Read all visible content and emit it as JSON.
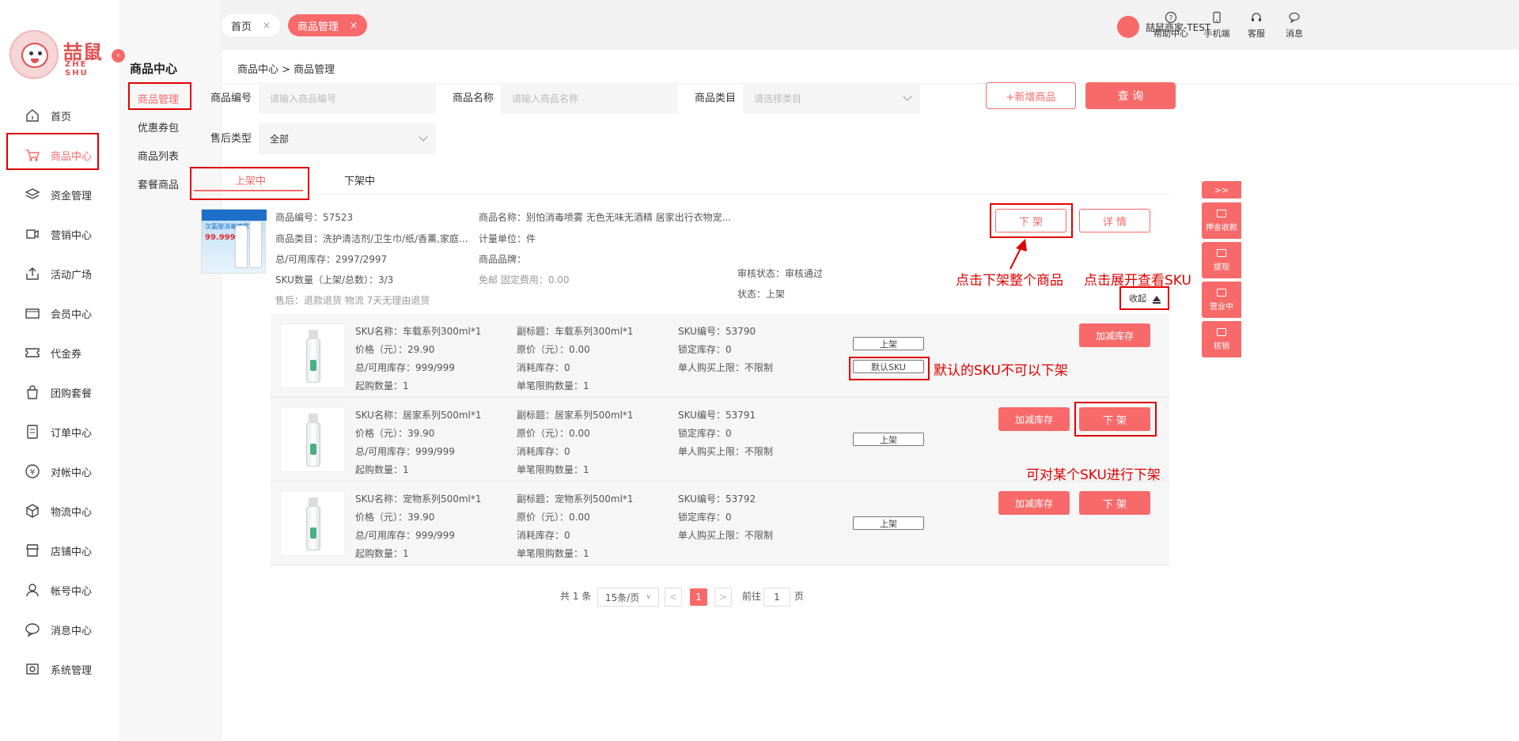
{
  "brand": {
    "name": "喆鼠",
    "sub": "ZHE SHU"
  },
  "nav": [
    {
      "label": "首页",
      "icon": "home-icon"
    },
    {
      "label": "商品中心",
      "icon": "cart-icon"
    },
    {
      "label": "资金管理",
      "icon": "layers-icon"
    },
    {
      "label": "营销中心",
      "icon": "marketing-icon"
    },
    {
      "label": "活动广场",
      "icon": "upload-box-icon"
    },
    {
      "label": "会员中心",
      "icon": "vip-card-icon"
    },
    {
      "label": "代金券",
      "icon": "coupon-icon"
    },
    {
      "label": "团购套餐",
      "icon": "bag-icon"
    },
    {
      "label": "订单中心",
      "icon": "order-icon"
    },
    {
      "label": "对帐中心",
      "icon": "yen-icon"
    },
    {
      "label": "物流中心",
      "icon": "box-icon"
    },
    {
      "label": "店铺中心",
      "icon": "store-icon"
    },
    {
      "label": "帐号中心",
      "icon": "user-icon"
    },
    {
      "label": "消息中心",
      "icon": "chat-icon"
    },
    {
      "label": "系统管理",
      "icon": "settings-icon"
    }
  ],
  "subnav": {
    "title": "商品中心",
    "items": [
      "商品管理",
      "优惠券包",
      "商品列表",
      "套餐商品"
    ]
  },
  "tabs": {
    "home": "首页",
    "current": "商品管理",
    "close": "×"
  },
  "toolbar": {
    "help": "帮助中心",
    "mobile": "手机端",
    "service": "客服",
    "message": "消息",
    "user": "喆鼠商家-TEST"
  },
  "breadcrumb": "商品中心  > 商品管理",
  "filters": {
    "code_label": "商品编号",
    "code_placeholder": "请输入商品编号",
    "name_label": "商品名称",
    "name_placeholder": "请输入商品名称",
    "category_label": "商品类目",
    "category_placeholder": "请选择类目",
    "aftersale_label": "售后类型",
    "aftersale_value": "全部",
    "add_button": "+新增商品",
    "query_button": "查 询"
  },
  "status_tabs": {
    "on": "上架中",
    "off": "下架中"
  },
  "product": {
    "code": "商品编号：57523",
    "name": "商品名称：别怕消毒喷雾 无色无味无酒精 居家出行衣物宠...",
    "category": "商品类目：洗护清洁剂/卫生巾/纸/香薰,家庭...",
    "unit": "计量单位：件",
    "stock": "总/可用库存：2997/2997",
    "brand": "商品品牌：",
    "sku_count": "SKU数量（上架/总数）：3/3",
    "shipping": "免邮   固定费用：0.00",
    "audit": "审核状态：审核通过",
    "aftersale": "售后：退款退货   物流   7天无理由退货",
    "status": "状态：上架",
    "img_title": "次氯酸消毒喷雾",
    "img_pct": "99.999%",
    "btn_off": "下 架",
    "btn_detail": "详 情",
    "collapse": "收起"
  },
  "skus": [
    {
      "name": "SKU名称：车载系列300ml*1",
      "subtitle": "副标题：车载系列300ml*1",
      "code": "SKU编号：53790",
      "price": "价格（元）：29.90",
      "orig": "原价（元）：0.00",
      "locked": "锁定库存：0",
      "stock": "总/可用库存：999/999",
      "consumed": "消耗库存：0",
      "limit": "单人购买上限：不限制",
      "min": "起购数量：1",
      "single": "单笔限购数量：1",
      "chip1": "上架",
      "chip2": "默认SKU",
      "btn_stock": "加减库存",
      "btn_off": ""
    },
    {
      "name": "SKU名称：居家系列500ml*1",
      "subtitle": "副标题：居家系列500ml*1",
      "code": "SKU编号：53791",
      "price": "价格（元）：39.90",
      "orig": "原价（元）：0.00",
      "locked": "锁定库存：0",
      "stock": "总/可用库存：999/999",
      "consumed": "消耗库存：0",
      "limit": "单人购买上限：不限制",
      "min": "起购数量：1",
      "single": "单笔限购数量：1",
      "chip1": "上架",
      "chip2": "",
      "btn_stock": "加减库存",
      "btn_off": "下 架"
    },
    {
      "name": "SKU名称：宠物系列500ml*1",
      "subtitle": "副标题：宠物系列500ml*1",
      "code": "SKU编号：53792",
      "price": "价格（元）：39.90",
      "orig": "原价（元）：0.00",
      "locked": "锁定库存：0",
      "stock": "总/可用库存：999/999",
      "consumed": "消耗库存：0",
      "limit": "单人购买上限：不限制",
      "min": "起购数量：1",
      "single": "单笔限购数量：1",
      "chip1": "上架",
      "chip2": "",
      "btn_stock": "加减库存",
      "btn_off": "下 架"
    }
  ],
  "annotations": {
    "a1": "点击下架整个商品",
    "a2": "点击展开查看SKU",
    "a3": "默认的SKU不可以下架",
    "a4": "可对某个SKU进行下架"
  },
  "pager": {
    "total": "共 1 条",
    "size": "15条/页",
    "prev": "<",
    "current": "1",
    "next": ">",
    "goto": "前往",
    "page": "1",
    "unit": "页"
  },
  "dock": {
    "toggle": ">>",
    "items": [
      "押金收款",
      "提现",
      "营业中",
      "核销"
    ]
  },
  "colors": {
    "accent": "#f86a6a",
    "annotation": "#e00000"
  }
}
